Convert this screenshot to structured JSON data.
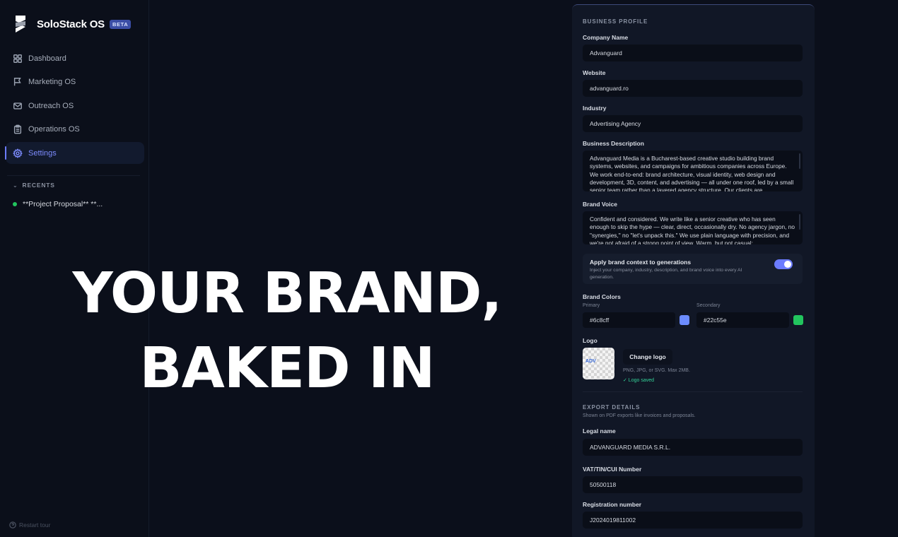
{
  "app": {
    "name": "SoloStack OS",
    "badge": "BETA"
  },
  "sidebar": {
    "items": [
      {
        "label": "Dashboard",
        "icon": "grid-icon"
      },
      {
        "label": "Marketing OS",
        "icon": "flag-icon"
      },
      {
        "label": "Outreach OS",
        "icon": "mail-icon"
      },
      {
        "label": "Operations OS",
        "icon": "clipboard-icon"
      },
      {
        "label": "Settings",
        "icon": "gear-icon",
        "active": true
      }
    ],
    "recents_title": "RECENTS",
    "recents": [
      {
        "label": "**Project Proposal** **...",
        "status_color": "#22c55e"
      }
    ],
    "restart_tour": "Restart tour"
  },
  "headline": {
    "line1": "YOUR BRAND,",
    "line2": "BAKED IN"
  },
  "business_profile": {
    "title": "BUSINESS PROFILE",
    "company_name": {
      "label": "Company Name",
      "value": "Advanguard"
    },
    "website": {
      "label": "Website",
      "value": "advanguard.ro"
    },
    "industry": {
      "label": "Industry",
      "value": "Advertising Agency"
    },
    "description": {
      "label": "Business Description",
      "value": "Advanguard Media is a Bucharest-based creative studio building brand systems, websites, and campaigns for ambitious companies across Europe. We work end-to-end: brand architecture, visual identity, web design and development, 3D, content, and advertising — all under one roof, led by a small senior team rather than a layered agency structure. Our clients are"
    },
    "brand_voice": {
      "label": "Brand Voice",
      "value": "Confident and considered. We write like a senior creative who has seen enough to skip the hype — clear, direct, occasionally dry. No agency jargon, no \"synergies,\" no \"let's unpack this.\" We use plain language with precision, and we're not afraid of a strong point of view. Warm, but not casual;"
    },
    "apply_context": {
      "title": "Apply brand context to generations",
      "description": "Inject your company, industry, description, and brand voice into every AI generation.",
      "enabled": true
    },
    "brand_colors": {
      "label": "Brand Colors",
      "primary_label": "Primary",
      "primary": "#6c8cff",
      "secondary_label": "Secondary",
      "secondary": "#22c55e"
    },
    "logo": {
      "label": "Logo",
      "button": "Change logo",
      "hint": "PNG, JPG, or SVG. Max 2MB.",
      "status": "✓ Logo saved"
    }
  },
  "export_details": {
    "title": "EXPORT DETAILS",
    "subtitle": "Shown on PDF exports like invoices and proposals.",
    "legal_name": {
      "label": "Legal name",
      "value": "ADVANGUARD MEDIA S.R.L."
    },
    "vat": {
      "label": "VAT/TIN/CUI Number",
      "value": "50500118"
    },
    "registration": {
      "label": "Registration number",
      "value": "J2024019811002"
    }
  },
  "colors": {
    "accent": "#6c7cff",
    "background": "#0b0f1b",
    "panel": "#111726"
  }
}
